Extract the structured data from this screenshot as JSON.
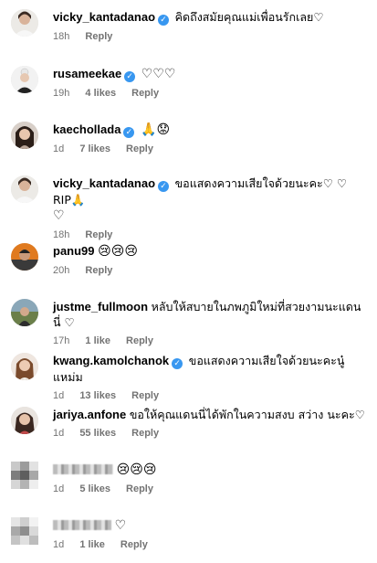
{
  "comments": [
    {
      "username": "vicky_kantadanao",
      "verified": true,
      "text": "คิดถึงสมัยคุณแม่เพื่อนรักเลย♡",
      "time": "18h",
      "likes": "",
      "reply": "Reply",
      "avatar": "woman-white-outfit"
    },
    {
      "username": "rusameekae",
      "verified": true,
      "text": "♡♡♡",
      "time": "19h",
      "likes": "4 likes",
      "reply": "Reply",
      "avatar": "woman-white-hair-bun"
    },
    {
      "username": "kaechollada",
      "verified": true,
      "text": "🙏😟",
      "time": "1d",
      "likes": "7 likes",
      "reply": "Reply",
      "avatar": "woman-dark-hair"
    },
    {
      "username": "vicky_kantadanao",
      "verified": true,
      "text": "ขอแสดงความเสียใจด้วยนะคะ♡ ♡ RIP🙏",
      "text2": "♡",
      "time": "18h",
      "likes": "",
      "reply": "Reply",
      "avatar": "woman-white-outfit"
    },
    {
      "username": "panu99",
      "verified": false,
      "text": "😢😢😢",
      "time": "20h",
      "likes": "",
      "reply": "Reply",
      "avatar": "man-orange-background"
    },
    {
      "username": "justme_fullmoon",
      "verified": false,
      "text": "หลับให้สบายในภพภูมิใหม่ที่สวยงามนะแดนนี่ ♡",
      "time": "17h",
      "likes": "1 like",
      "reply": "Reply",
      "avatar": "outdoor-photo"
    },
    {
      "username": "kwang.kamolchanok",
      "verified": true,
      "text": "ขอแสดงความเสียใจด้วยนะคะนู๋แหม่ม",
      "time": "1d",
      "likes": "13 likes",
      "reply": "Reply",
      "avatar": "woman-brown-hair"
    },
    {
      "username": "jariya.anfone",
      "verified": false,
      "text": "ขอให้คุณแดนนี่ได้พักในความสงบ สว่าง นะคะ♡",
      "time": "1d",
      "likes": "55 likes",
      "reply": "Reply",
      "avatar": "woman-long-hair"
    },
    {
      "username": "",
      "verified": false,
      "text": "😢😢😢",
      "time": "1d",
      "likes": "5 likes",
      "reply": "Reply",
      "avatar": "pixelated"
    },
    {
      "username": "",
      "verified": false,
      "text": "♡",
      "time": "1d",
      "likes": "1 like",
      "reply": "Reply",
      "avatar": "pixelated"
    }
  ],
  "colors": {
    "verified": "#3897f0",
    "meta": "#737373",
    "text": "#000000",
    "background": "#ffffff"
  }
}
